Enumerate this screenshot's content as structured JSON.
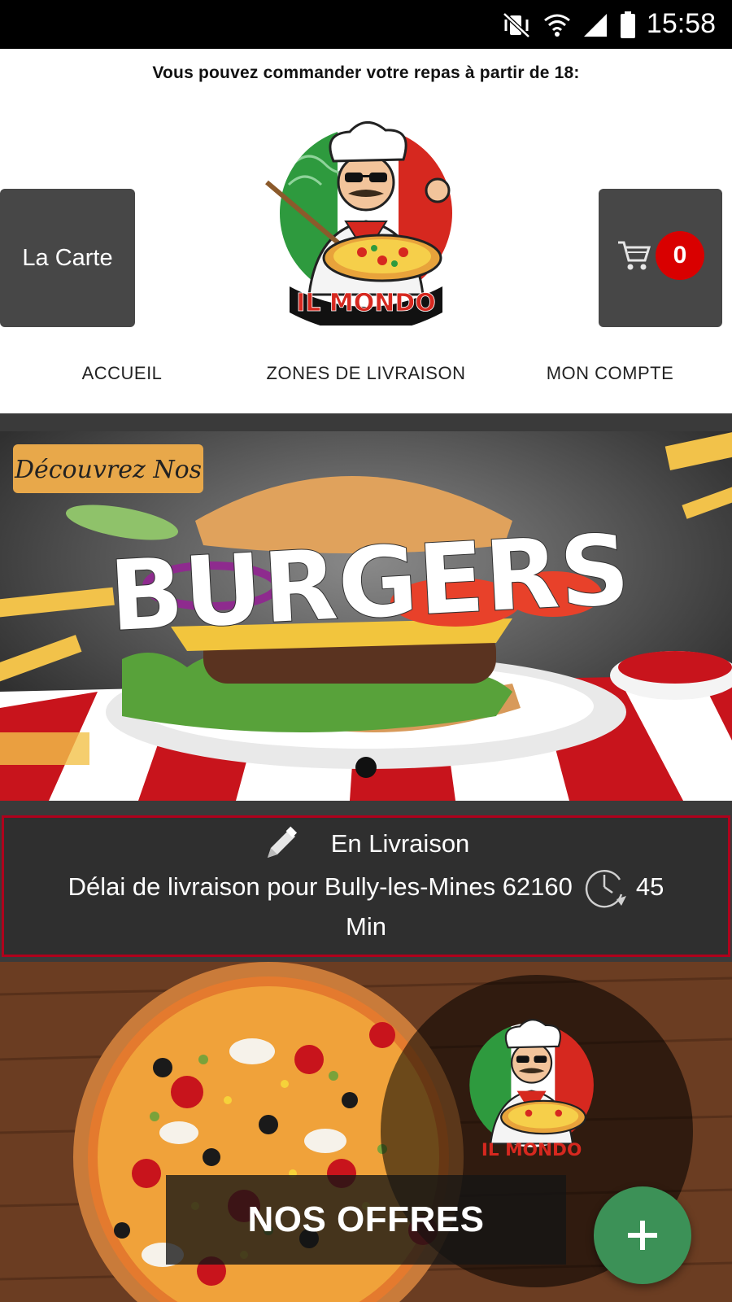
{
  "status_bar": {
    "time": "15:58",
    "icons": [
      "mute-vibrate-icon",
      "wifi-icon",
      "signal-icon",
      "battery-icon"
    ]
  },
  "marquee": {
    "text": "Vous pouvez commander votre repas à partir de 18:"
  },
  "header": {
    "menu_button_label": "La Carte",
    "cart_count": "0",
    "logo_name": "IL MONDO"
  },
  "tabs": [
    {
      "label": "ACCUEIL",
      "selected": true
    },
    {
      "label": "ZONES DE LIVRAISON",
      "selected": false
    },
    {
      "label": "MON COMPTE",
      "selected": false
    }
  ],
  "banner": {
    "tagline": "Découvrez Nos",
    "headline": "BURGERS",
    "slide_count": 1,
    "active_slide": 1
  },
  "delivery": {
    "mode": "En Livraison",
    "delay_text": "Délai de livraison pour Bully-les-Mines 62160",
    "duration_value": "45",
    "duration_unit": "Min"
  },
  "offers": {
    "label": "NOS OFFRES",
    "logo_name": "IL MONDO"
  },
  "colors": {
    "accent_red": "#d90000",
    "dark_button": "#474747",
    "fab_green": "#3c9157",
    "delivery_border": "#b0001c"
  }
}
